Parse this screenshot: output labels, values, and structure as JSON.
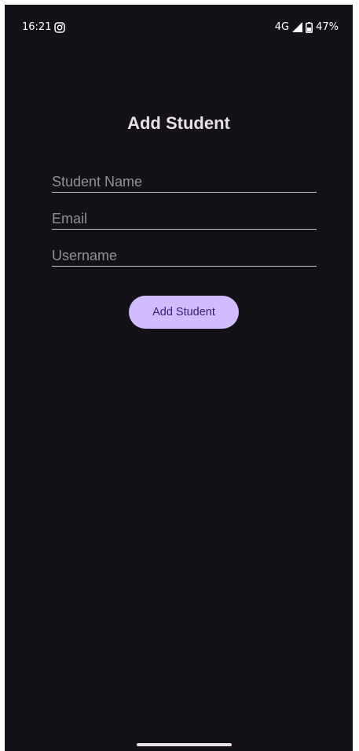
{
  "status_bar": {
    "time": "16:21",
    "notification_icon": "instagram-icon",
    "network": "4G",
    "signal_icon": "signal-icon",
    "battery_icon": "battery-icon",
    "battery_percent": "47%"
  },
  "form": {
    "title": "Add Student",
    "fields": [
      {
        "placeholder": "Student Name",
        "value": ""
      },
      {
        "placeholder": "Email",
        "value": ""
      },
      {
        "placeholder": "Username",
        "value": ""
      }
    ],
    "submit_label": "Add Student"
  },
  "colors": {
    "background": "#141218",
    "title_text": "#e6e1e5",
    "placeholder_text": "#938f99",
    "underline": "#cac4d0",
    "button_bg": "#d0bcff",
    "button_text": "#381e72"
  },
  "navigation": {
    "gesture_handle_icon": "gesture-handle"
  }
}
